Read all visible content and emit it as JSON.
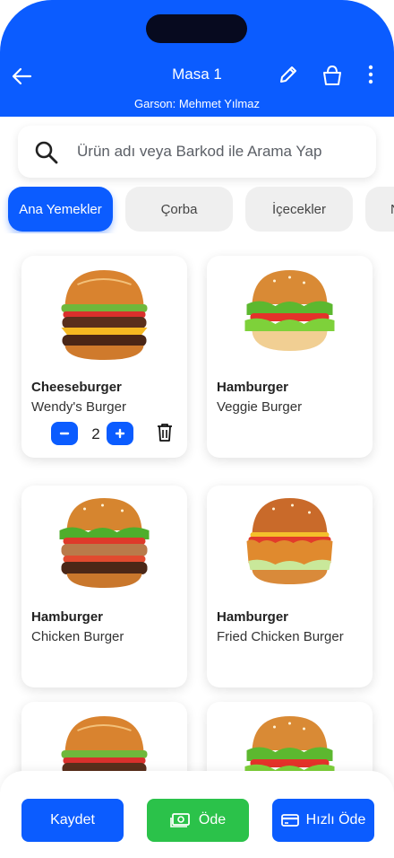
{
  "header": {
    "title": "Masa 1",
    "subtitle": "Garson: Mehmet Yılmaz"
  },
  "search": {
    "placeholder": "Ürün adı veya Barkod ile Arama Yap"
  },
  "categories": [
    {
      "label": "Ana Yemekler",
      "active": true
    },
    {
      "label": "Çorba",
      "active": false
    },
    {
      "label": "İçecekler",
      "active": false
    },
    {
      "label": "N",
      "active": false
    }
  ],
  "products": [
    {
      "name": "Cheeseburger",
      "sub": "Wendy's Burger",
      "quantity": "2"
    },
    {
      "name": "Hamburger",
      "sub": "Veggie Burger"
    },
    {
      "name": "Hamburger",
      "sub": "Chicken Burger"
    },
    {
      "name": "Hamburger",
      "sub": "Fried Chicken Burger"
    }
  ],
  "actions": {
    "save": "Kaydet",
    "pay": "Öde",
    "quick_pay": "Hızlı Öde"
  },
  "colors": {
    "primary": "#0b5cff",
    "pay": "#2bc24a"
  }
}
